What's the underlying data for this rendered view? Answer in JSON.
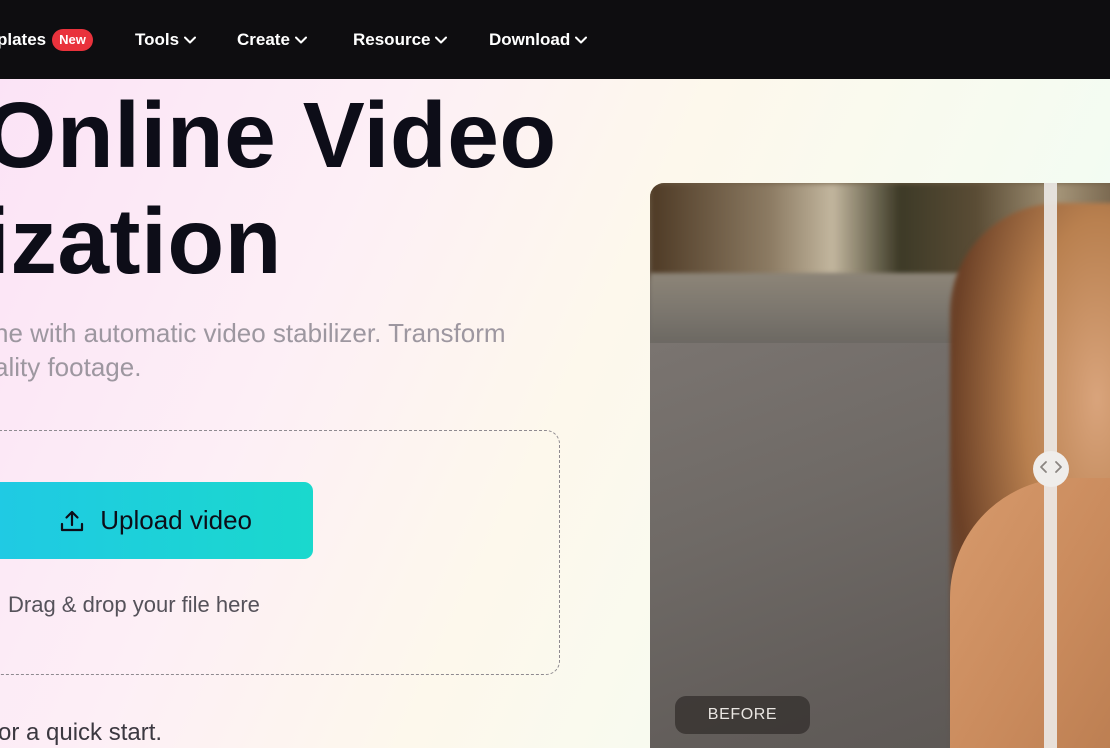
{
  "nav": {
    "items": [
      {
        "label": "plates",
        "badge": "New"
      },
      {
        "label": "Tools"
      },
      {
        "label": "Create"
      },
      {
        "label": "Resource"
      },
      {
        "label": "Download"
      }
    ],
    "icons": {
      "chevron": "chevron-down-icon"
    }
  },
  "hero": {
    "title_line1": "Online Video",
    "title_line2": "ization",
    "subtitle_line1": "ne with automatic video stabilizer. Transform",
    "subtitle_line2": "ality footage."
  },
  "upload": {
    "button_label": "Upload video",
    "icon": "upload-icon",
    "drag_text": "Drag & drop your file here"
  },
  "quick_start_text": "or a quick start.",
  "preview": {
    "before_label": "BEFORE",
    "handle_icon": "compare-arrows-icon"
  },
  "colors": {
    "nav_bg": "#0e0d10",
    "badge_bg": "#e9323c",
    "button_gradient_start": "#20c9e5",
    "button_gradient_end": "#1ad8cd",
    "title": "#0d0d18",
    "subtitle": "#9d97a0"
  }
}
